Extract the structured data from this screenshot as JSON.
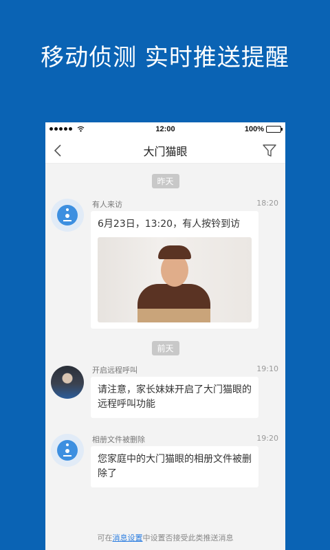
{
  "promo": {
    "title": "移动侦测  实时推送提醒"
  },
  "status_bar": {
    "time": "12:00",
    "battery": "100%",
    "battery_level": 1.0
  },
  "nav": {
    "title": "大门猫眼"
  },
  "feed": {
    "day1": "昨天",
    "day2": "前天",
    "messages": [
      {
        "title": "有人来访",
        "time": "18:20",
        "text": "6月23日，13:20，有人按铃到访",
        "avatar": "camera-icon"
      },
      {
        "title": "开启远程呼叫",
        "time": "19:10",
        "text": "请注意，家长妹妹开启了大门猫眼的远程呼叫功能",
        "avatar": "user-photo"
      },
      {
        "title": "相册文件被删除",
        "time": "19:20",
        "text": "您家庭中的大门猫眼的相册文件被删除了",
        "avatar": "camera-icon"
      }
    ]
  },
  "footer": {
    "prefix": "可在",
    "link": "消息设置",
    "suffix": "中设置否接受此类推送消息"
  },
  "colors": {
    "background": "#0a63b4",
    "accent": "#3d8fe0",
    "link": "#2b7de0"
  }
}
